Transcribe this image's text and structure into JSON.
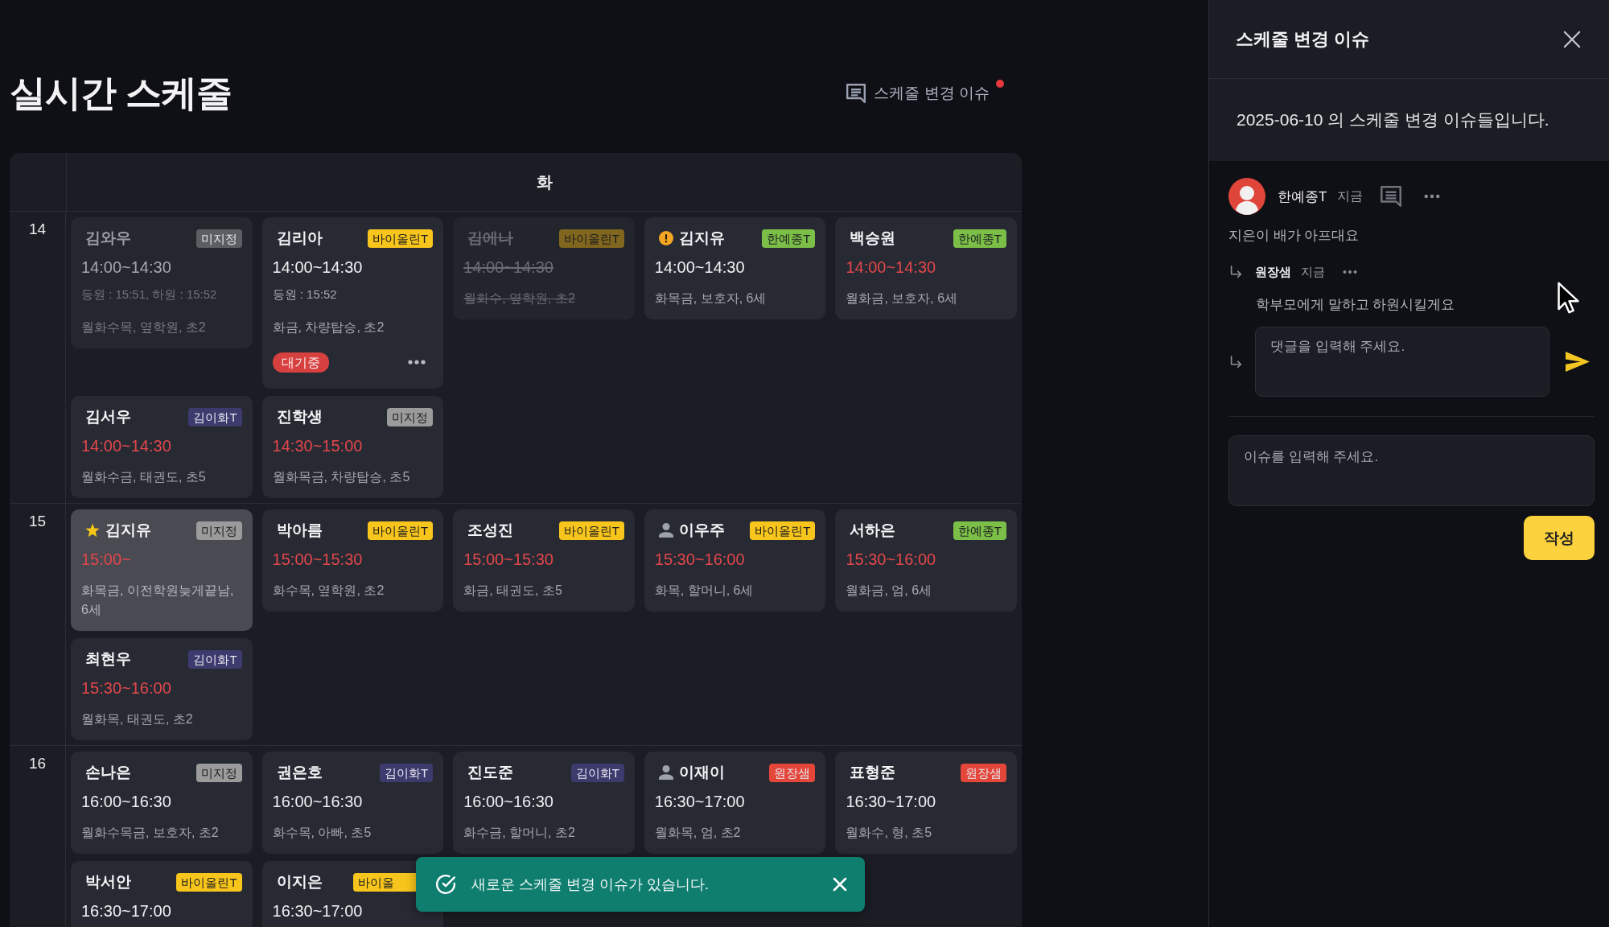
{
  "page": {
    "title": "실시간 스케줄",
    "issues_button": {
      "label": "스케줄 변경 이슈",
      "unread": true
    }
  },
  "schedule": {
    "day_header": "화",
    "rows": [
      {
        "hour": "14",
        "cards": [
          {
            "kind": "plain",
            "name": "김와우",
            "teacher": {
              "label": "미지정",
              "color": "#5d5e63",
              "covered": false
            },
            "time": "14:00~14:30",
            "overdue": false,
            "attendance": "등원 : 15:51, 하원 : 15:52",
            "info": "월화수목, 옆학원, 초2",
            "finished": true,
            "cancelled": false,
            "selected": false
          },
          {
            "kind": "plain",
            "name": "김리아",
            "teacher": {
              "label": "바이올린T",
              "color": "#f7c51c",
              "covered": false
            },
            "time": "14:00~14:30",
            "overdue": false,
            "attendance": "등원 : 15:52",
            "info": "화금, 차량탑승, 초2",
            "status_badge": "대기중",
            "finished": false,
            "cancelled": false,
            "selected": false
          },
          {
            "kind": "plain",
            "name": "김에나",
            "teacher": {
              "label": "바이올린T",
              "color": "#80661e",
              "covered": false
            },
            "time": "14:00~14:30",
            "overdue": false,
            "info": "월화수, 옆학원, 초2",
            "finished": false,
            "cancelled": true,
            "selected": false
          },
          {
            "kind": "warning",
            "name": "김지유",
            "teacher": {
              "label": "한예종T",
              "color": "#7cbf48",
              "covered": false
            },
            "time": "14:00~14:30",
            "overdue": false,
            "info": "화목금, 보호자, 6세",
            "finished": false,
            "cancelled": false,
            "selected": false
          },
          {
            "kind": "plain",
            "name": "백승원",
            "teacher": {
              "label": "한예종T",
              "color": "#7cbf48",
              "covered": false
            },
            "time": "14:00~14:30",
            "overdue": true,
            "info": "월화금, 보호자, 6세",
            "finished": false,
            "cancelled": false,
            "selected": false
          },
          {
            "kind": "plain",
            "name": "김서우",
            "teacher": {
              "label": "김이화T",
              "color": "#3d3a6e",
              "covered": false
            },
            "time": "14:00~14:30",
            "overdue": true,
            "info": "월화수금, 태권도, 초5",
            "finished": false,
            "cancelled": false,
            "selected": false
          },
          {
            "kind": "plain",
            "name": "진학생",
            "teacher": {
              "label": "미지정",
              "color": "#9b9b9b",
              "covered": false
            },
            "time": "14:30~15:00",
            "overdue": true,
            "info": "월화목금, 차량탑승, 초5",
            "finished": false,
            "cancelled": false,
            "selected": false
          }
        ]
      },
      {
        "hour": "15",
        "cards": [
          {
            "kind": "star",
            "name": "김지유",
            "teacher": {
              "label": "미지정",
              "color": "#9b9b9b",
              "covered": false
            },
            "time": "15:00~",
            "overdue": true,
            "info": "화목금, 이전학원늦게끝남, 6세",
            "finished": false,
            "cancelled": false,
            "selected": true
          },
          {
            "kind": "plain",
            "name": "박아름",
            "teacher": {
              "label": "바이올린T",
              "color": "#f7c51c",
              "covered": false
            },
            "time": "15:00~15:30",
            "overdue": true,
            "info": "화수목, 옆학원, 초2",
            "finished": false,
            "cancelled": false,
            "selected": false
          },
          {
            "kind": "plain",
            "name": "조성진",
            "teacher": {
              "label": "바이올린T",
              "color": "#f7c51c",
              "covered": false
            },
            "time": "15:00~15:30",
            "overdue": true,
            "info": "화금, 태권도, 초5",
            "finished": false,
            "cancelled": false,
            "selected": false
          },
          {
            "kind": "person",
            "name": "이우주",
            "teacher": {
              "label": "바이올린T",
              "color": "#f7c51c",
              "covered": false
            },
            "time": "15:30~16:00",
            "overdue": true,
            "info": "화목, 할머니, 6세",
            "finished": false,
            "cancelled": false,
            "selected": false
          },
          {
            "kind": "plain",
            "name": "서하은",
            "teacher": {
              "label": "한예종T",
              "color": "#7cbf48",
              "covered": false
            },
            "time": "15:30~16:00",
            "overdue": true,
            "info": "월화금, 엄, 6세",
            "finished": false,
            "cancelled": false,
            "selected": false
          },
          {
            "kind": "plain",
            "name": "최현우",
            "teacher": {
              "label": "김이화T",
              "color": "#3d3a6e",
              "covered": false
            },
            "time": "15:30~16:00",
            "overdue": true,
            "info": "월화목, 태권도, 초2",
            "finished": false,
            "cancelled": false,
            "selected": false
          }
        ]
      },
      {
        "hour": "16",
        "cards": [
          {
            "kind": "plain",
            "name": "손나은",
            "teacher": {
              "label": "미지정",
              "color": "#9b9b9b",
              "covered": false
            },
            "time": "16:00~16:30",
            "overdue": false,
            "info": "월화수목금, 보호자, 초2",
            "finished": false,
            "cancelled": false,
            "selected": false
          },
          {
            "kind": "plain",
            "name": "권은호",
            "teacher": {
              "label": "김이화T",
              "color": "#3d3a6e",
              "covered": false
            },
            "time": "16:00~16:30",
            "overdue": false,
            "info": "화수목, 아빠, 초5",
            "finished": false,
            "cancelled": false,
            "selected": false
          },
          {
            "kind": "plain",
            "name": "진도준",
            "teacher": {
              "label": "김이화T",
              "color": "#3d3a6e",
              "covered": false
            },
            "time": "16:00~16:30",
            "overdue": false,
            "info": "화수금, 할머니, 초2",
            "finished": false,
            "cancelled": false,
            "selected": false
          },
          {
            "kind": "person",
            "name": "이재이",
            "teacher": {
              "label": "원장샘",
              "color": "#e5463a",
              "covered": false
            },
            "time": "16:30~17:00",
            "overdue": false,
            "info": "월화목, 엄, 초2",
            "finished": false,
            "cancelled": false,
            "selected": false
          },
          {
            "kind": "plain",
            "name": "표형준",
            "teacher": {
              "label": "원장샘",
              "color": "#e5463a",
              "covered": false
            },
            "time": "16:30~17:00",
            "overdue": false,
            "info": "월화수, 형, 초5",
            "finished": false,
            "cancelled": false,
            "selected": false
          },
          {
            "kind": "plain",
            "name": "박서안",
            "teacher": {
              "label": "바이올린T",
              "color": "#f7c51c",
              "covered": false
            },
            "time": "16:30~17:00",
            "overdue": false,
            "finished": false,
            "cancelled": false,
            "selected": false
          },
          {
            "kind": "plain",
            "name": "이지은",
            "teacher": {
              "label": "바이올",
              "color": "#f7c51c",
              "covered": true
            },
            "time": "16:30~17:00",
            "overdue": false,
            "finished": false,
            "cancelled": false,
            "selected": false
          }
        ]
      }
    ]
  },
  "toast": {
    "message": "새로운 스케줄 변경 이슈가 있습니다."
  },
  "issue_panel": {
    "title": "스케줄 변경 이슈",
    "description": "2025-06-10 의 스케줄 변경 이슈들입니다.",
    "issues": [
      {
        "author": "한예종T",
        "time": "지금",
        "text": "지은이 배가 아프대요",
        "replies": [
          {
            "author": "원장샘",
            "time": "지금",
            "text": "학부모에게 말하고 하원시킬게요"
          }
        ],
        "reply_placeholder": "댓글을 입력해 주세요."
      }
    ],
    "issue_placeholder": "이슈를 입력해 주세요.",
    "submit_label": "작성"
  }
}
